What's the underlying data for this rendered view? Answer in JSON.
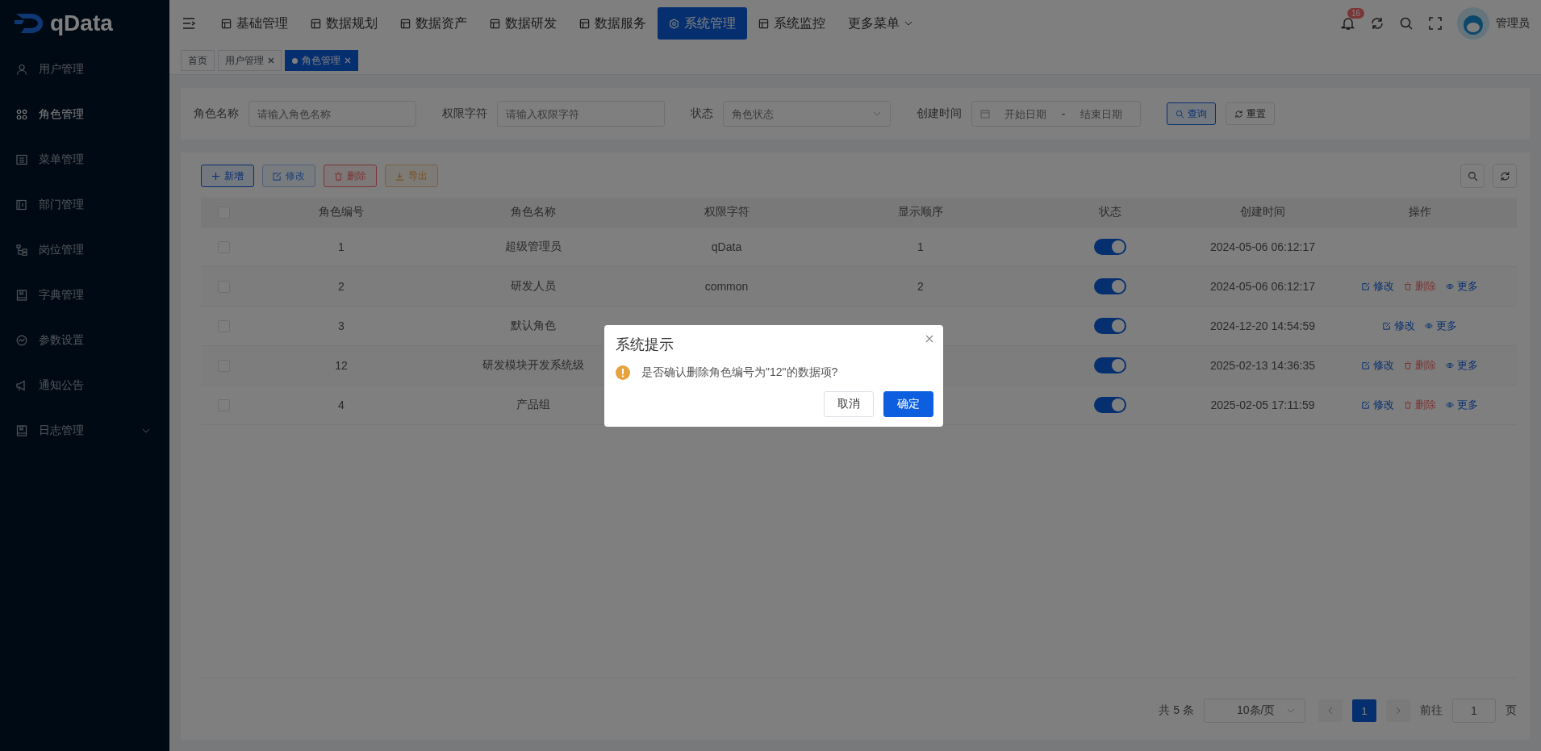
{
  "logo": {
    "text": "qData"
  },
  "sidebar": {
    "items": [
      {
        "label": "用户管理",
        "selected": false
      },
      {
        "label": "角色管理",
        "selected": true
      },
      {
        "label": "菜单管理",
        "selected": false
      },
      {
        "label": "部门管理",
        "selected": false
      },
      {
        "label": "岗位管理",
        "selected": false
      },
      {
        "label": "字典管理",
        "selected": false
      },
      {
        "label": "参数设置",
        "selected": false
      },
      {
        "label": "通知公告",
        "selected": false
      },
      {
        "label": "日志管理",
        "selected": false,
        "expandable": true
      }
    ]
  },
  "top_nav": {
    "items": [
      {
        "label": "基础管理",
        "selected": false
      },
      {
        "label": "数据规划",
        "selected": false
      },
      {
        "label": "数据资产",
        "selected": false
      },
      {
        "label": "数据研发",
        "selected": false
      },
      {
        "label": "数据服务",
        "selected": false
      },
      {
        "label": "系统管理",
        "selected": true
      },
      {
        "label": "系统监控",
        "selected": false
      },
      {
        "label": "更多菜单",
        "selected": false,
        "dropdown": true
      }
    ],
    "notification_count": "16",
    "user": "管理员"
  },
  "tags": [
    {
      "label": "首页",
      "selected": false,
      "closable": false
    },
    {
      "label": "用户管理",
      "selected": false,
      "closable": true
    },
    {
      "label": "角色管理",
      "selected": true,
      "closable": true
    }
  ],
  "filters": [
    {
      "label": "角色名称",
      "placeholder": "请输入角色名称",
      "kind": "text"
    },
    {
      "label": "权限字符",
      "placeholder": "请输入权限字符",
      "kind": "text"
    },
    {
      "label": "状态",
      "placeholder": "角色状态",
      "kind": "select"
    },
    {
      "label": "创建时间",
      "placeholder": "开始日期",
      "separator": "-",
      "placeholder_end": "结束日期",
      "kind": "daterange"
    }
  ],
  "filter_buttons": [
    {
      "label": "查询",
      "kind": "primary"
    },
    {
      "label": "重置",
      "kind": "plain"
    }
  ],
  "toolbar": [
    {
      "label": "新增",
      "kind": "add",
      "disabled": false
    },
    {
      "label": "修改",
      "kind": "edit",
      "disabled": true
    },
    {
      "label": "删除",
      "kind": "delete",
      "disabled": false
    },
    {
      "label": "导出",
      "kind": "export",
      "disabled": false
    }
  ],
  "table": {
    "select_all_checked": false,
    "columns": [
      "角色编号",
      "角色名称",
      "权限字符",
      "显示顺序",
      "状态",
      "创建时间",
      "操作"
    ],
    "rows": [
      {
        "checked": false,
        "id": "1",
        "name": "超级管理员",
        "key": "qData",
        "order": "1",
        "on": true,
        "created": "2024-05-06 06:12:17",
        "actions": []
      },
      {
        "checked": false,
        "id": "2",
        "name": "研发人员",
        "key": "common",
        "order": "2",
        "on": true,
        "created": "2024-05-06 06:12:17",
        "actions": [
          {
            "label": "修改",
            "kind": "edit"
          },
          {
            "label": "删除",
            "kind": "delete"
          },
          {
            "label": "更多",
            "kind": "more"
          }
        ]
      },
      {
        "checked": false,
        "id": "3",
        "name": "默认角色",
        "on": true,
        "created": "2024-12-20 14:54:59",
        "actions": [
          {
            "label": "修改",
            "kind": "edit"
          },
          {
            "label": "更多",
            "kind": "more"
          }
        ]
      },
      {
        "checked": false,
        "id": "12",
        "name": "研发模块开发系统级",
        "on": true,
        "created": "2025-02-13 14:36:35",
        "actions": [
          {
            "label": "修改",
            "kind": "edit"
          },
          {
            "label": "删除",
            "kind": "delete"
          },
          {
            "label": "更多",
            "kind": "more"
          }
        ]
      },
      {
        "checked": false,
        "id": "4",
        "name": "产品组",
        "on": true,
        "created": "2025-02-05 17:11:59",
        "actions": [
          {
            "label": "修改",
            "kind": "edit"
          },
          {
            "label": "删除",
            "kind": "delete"
          },
          {
            "label": "更多",
            "kind": "more"
          }
        ]
      }
    ]
  },
  "pagination": {
    "total": "共 5 条",
    "page_size": "10条/页",
    "pages": [
      {
        "label": "1",
        "selected": true
      }
    ],
    "goto_label": "前往",
    "goto_value": "1",
    "goto_suffix": "页"
  },
  "dialog": {
    "title": "系统提示",
    "message": "是否确认删除角色编号为\"12\"的数据项?",
    "buttons": [
      {
        "label": "取消",
        "kind": "plain"
      },
      {
        "label": "确定",
        "kind": "primary"
      }
    ]
  }
}
